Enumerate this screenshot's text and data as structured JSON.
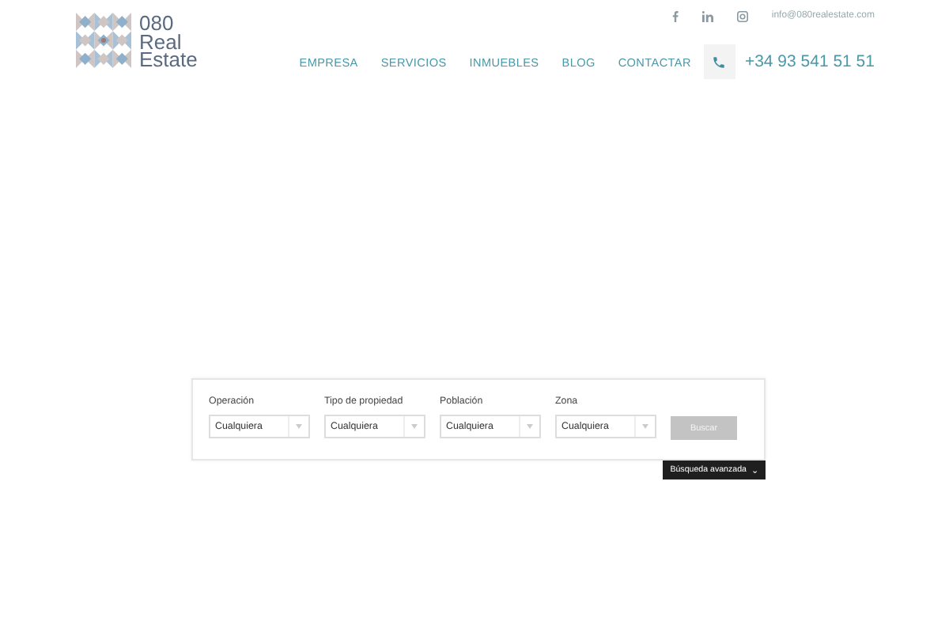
{
  "logo": {
    "lines": [
      "080",
      "Real",
      "Estate"
    ]
  },
  "top_bar": {
    "social": [
      {
        "kind": "facebook"
      },
      {
        "kind": "linkedin"
      },
      {
        "kind": "instagram"
      }
    ],
    "email": "info@080realestate.com"
  },
  "nav": {
    "items": [
      "EMPRESA",
      "SERVICIOS",
      "INMUEBLES",
      "BLOG",
      "CONTACTAR"
    ],
    "phone": "+34 93 541 51 51"
  },
  "search": {
    "fields": [
      {
        "label": "Operación",
        "value": "Cualquiera"
      },
      {
        "label": "Tipo de propiedad",
        "value": "Cualquiera"
      },
      {
        "label": "Población",
        "value": "Cualquiera"
      },
      {
        "label": "Zona",
        "value": "Cualquiera"
      }
    ],
    "button": "Buscar",
    "advanced": "Búsqueda avanzada",
    "advanced_icon": "⌄"
  }
}
